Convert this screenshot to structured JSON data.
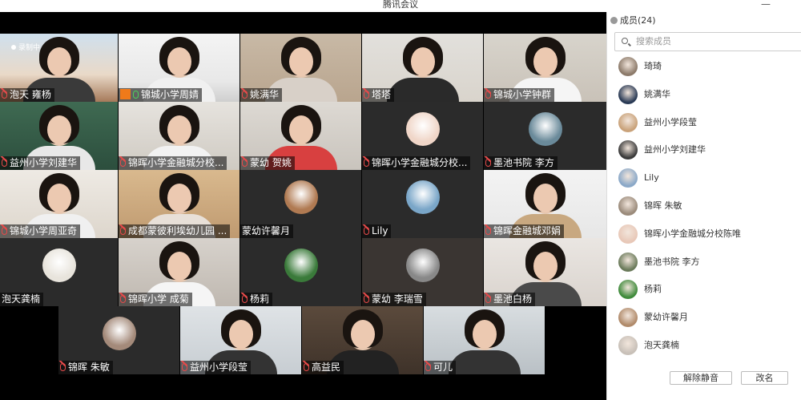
{
  "window": {
    "title": "腾讯会议",
    "minimize": "—",
    "close": "✕"
  },
  "video": {
    "recording_label": "录制中",
    "tiles": [
      {
        "name": "泡天 雍杨",
        "mic": "muted"
      },
      {
        "name": "锦城小学周婧",
        "mic": "active",
        "host": true
      },
      {
        "name": "姚满华",
        "mic": "muted"
      },
      {
        "name": "塔塔",
        "mic": "muted"
      },
      {
        "name": "锦城小学钟群",
        "mic": "muted"
      },
      {
        "name": "益州小学刘建华",
        "mic": "muted"
      },
      {
        "name": "锦晖小学金融城分校...",
        "mic": "muted"
      },
      {
        "name": "蒙幼  贺姚",
        "mic": "muted"
      },
      {
        "name": "锦晖小学金融城分校...",
        "mic": "muted"
      },
      {
        "name": "墨池书院  李方",
        "mic": "muted"
      },
      {
        "name": "锦城小学周亚奇",
        "mic": "muted"
      },
      {
        "name": "成都蒙彼利埃幼儿园 ...",
        "mic": "muted"
      },
      {
        "name": "蒙幼许馨月",
        "mic": "none"
      },
      {
        "name": "Lily",
        "mic": "muted"
      },
      {
        "name": "锦晖金融城邓娟",
        "mic": "muted"
      },
      {
        "name": "泡天龚楠",
        "mic": "none"
      },
      {
        "name": "锦晖小学  成菊",
        "mic": "muted"
      },
      {
        "name": "杨莉",
        "mic": "muted"
      },
      {
        "name": "蒙幼  李瑞雪",
        "mic": "muted"
      },
      {
        "name": "墨池白杨",
        "mic": "muted"
      },
      {
        "name": "锦晖  朱敏",
        "mic": "muted"
      },
      {
        "name": "益州小学段莹",
        "mic": "muted"
      },
      {
        "name": "高益民",
        "mic": "muted"
      },
      {
        "name": "可儿",
        "mic": "muted"
      }
    ]
  },
  "panel": {
    "title": "成员(24)",
    "search_placeholder": "搜索成员",
    "members": [
      {
        "name": "琦琦",
        "avatar_color": "#8c7a6a"
      },
      {
        "name": "姚满华",
        "avatar_color": "#2a3a55"
      },
      {
        "name": "益州小学段莹",
        "avatar_color": "#c9a27a"
      },
      {
        "name": "益州小学刘建华",
        "avatar_color": "#3a3a3a"
      },
      {
        "name": "Lily",
        "avatar_color": "#8aa8c8"
      },
      {
        "name": "锦晖 朱敏",
        "avatar_color": "#9a8a7a"
      },
      {
        "name": "锦晖小学金融城分校陈唯",
        "avatar_color": "#e8c8b8"
      },
      {
        "name": "墨池书院 李方",
        "avatar_color": "#6a7a5a"
      },
      {
        "name": "杨莉",
        "avatar_color": "#3e8a3a"
      },
      {
        "name": "蒙幼许馨月",
        "avatar_color": "#b08a6a"
      },
      {
        "name": "泡天龚楠",
        "avatar_color": "#c8c0b8"
      }
    ],
    "unmute_all_label": "解除静音",
    "rename_label": "改名"
  },
  "colors": {
    "stage_bg": "#000000",
    "muted_mic": "#e84a4a",
    "active_mic": "#4bd35a",
    "host_badge": "#f07a1a"
  }
}
